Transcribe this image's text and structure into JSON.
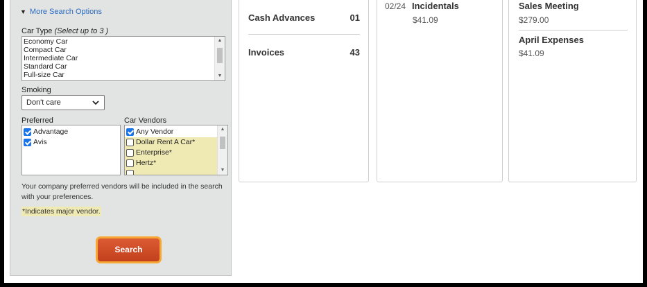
{
  "search_panel": {
    "more_options": "More Search Options",
    "car_type_label": "Car Type",
    "car_type_hint": "(Select up to 3 )",
    "car_types": [
      "Economy Car",
      "Compact Car",
      "Intermediate Car",
      "Standard Car",
      "Full-size Car"
    ],
    "smoking_label": "Smoking",
    "smoking_value": "Don't care",
    "preferred_label": "Preferred",
    "preferred": [
      {
        "label": "Advantage",
        "checked": true
      },
      {
        "label": "Avis",
        "checked": true
      }
    ],
    "vendors_label": "Car Vendors",
    "vendors": [
      {
        "label": "Any Vendor",
        "checked": true
      },
      {
        "label": "Dollar Rent A Car*",
        "checked": false
      },
      {
        "label": "Enterprise*",
        "checked": false
      },
      {
        "label": "Hertz*",
        "checked": false
      }
    ],
    "preferred_note": "Your company preferred vendors will be included in the search with your preferences.",
    "major_note": "*Indicates major vendor.",
    "search_button": "Search"
  },
  "cards": {
    "summary": {
      "cash_advances_label": "Cash Advances",
      "cash_advances_count": "01",
      "invoices_label": "Invoices",
      "invoices_count": "43"
    },
    "expenses": {
      "date": "02/24",
      "label": "Incidentals",
      "amount": "$41.09"
    },
    "reports": [
      {
        "title": "Sales Meeting",
        "amount": "$279.00"
      },
      {
        "title": "April Expenses",
        "amount": "$41.09"
      }
    ]
  },
  "colors": {
    "accent_link": "#2a6bbf",
    "search_button": "#c9461f",
    "search_focus_ring": "#f7a733",
    "vendor_highlight": "#efe9b3"
  }
}
